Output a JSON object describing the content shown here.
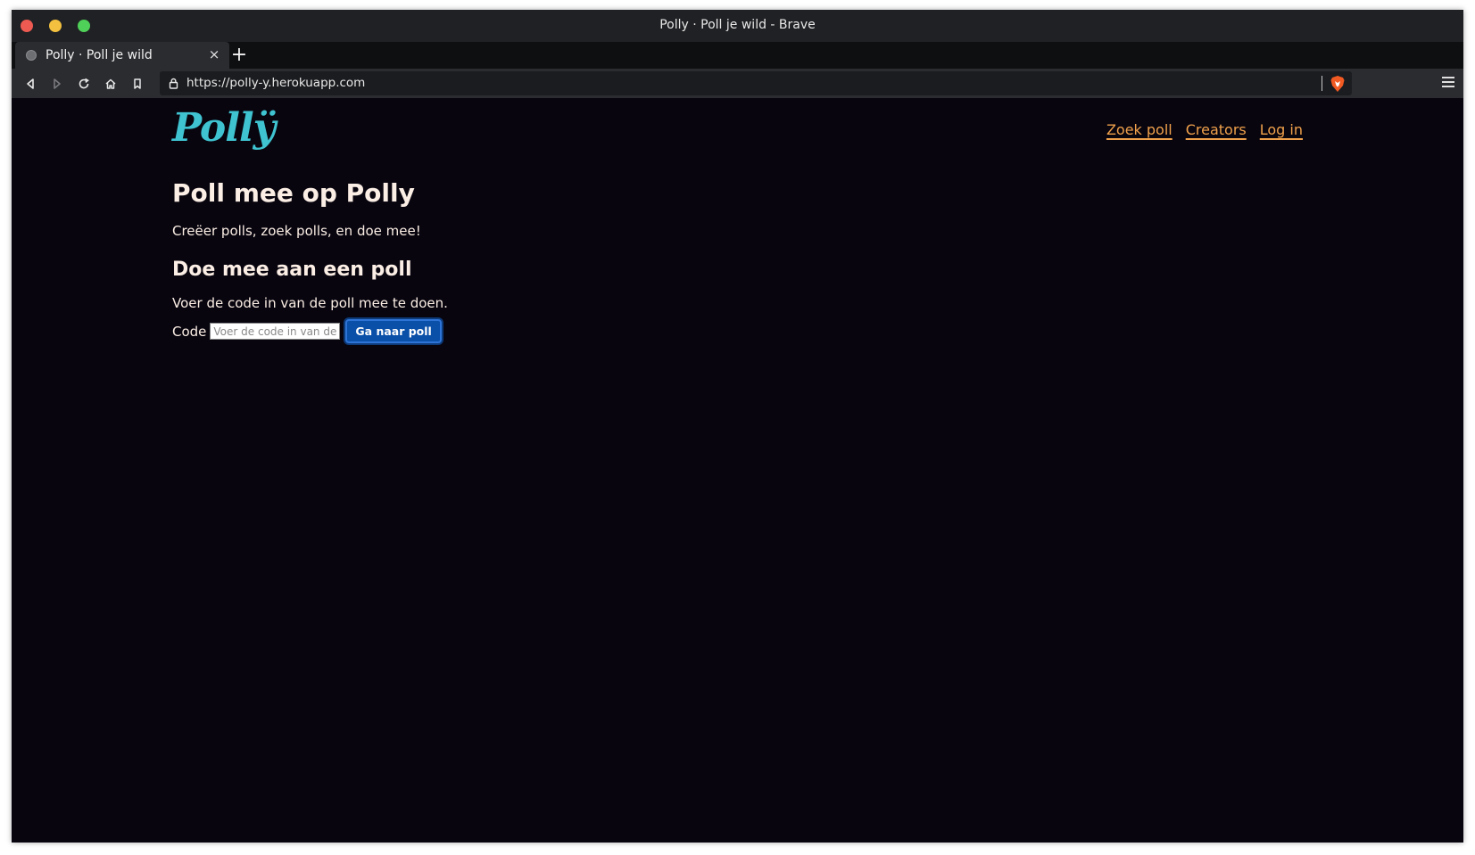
{
  "browser": {
    "window_title": "Polly · Poll je wild - Brave",
    "tab_title": "Polly · Poll je wild",
    "tab_close": "×",
    "new_tab": "+",
    "url": "https://polly-y.herokuapp.com"
  },
  "site": {
    "logo_text": "Pollÿ",
    "nav": {
      "search": "Zoek poll",
      "creators": "Creators",
      "login": "Log in"
    }
  },
  "main": {
    "title": "Poll mee op Polly",
    "intro": "Creëer polls, zoek polls, en doe mee!",
    "join_heading": "Doe mee aan een poll",
    "join_instructions": "Voer de code in van de poll mee te doen.",
    "code_label": "Code",
    "code_placeholder": "Voer de code in van de poll",
    "code_value": "",
    "submit_label": "Ga naar poll"
  },
  "colors": {
    "background": "#08050f",
    "logo": "#3fc3d0",
    "nav_link": "#f0a14b",
    "text": "#fbeee4",
    "button": "#0a4fa8"
  }
}
